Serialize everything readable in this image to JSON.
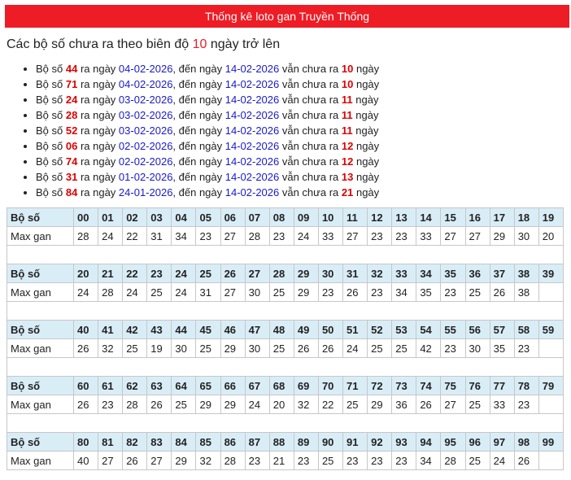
{
  "header": {
    "title": "Thống kê loto gan Truyền Thống"
  },
  "subtitle": {
    "prefix": "Các bộ số chưa ra theo biên độ ",
    "amplitude": "10",
    "suffix": " ngày trở lên"
  },
  "gan_list": {
    "label_prefix": "Bộ số ",
    "label_ra_ngay": " ra ngày ",
    "label_den_ngay": ", đến ngày ",
    "label_van_chua_ra": " vẫn chưa ra ",
    "label_ngay": " ngày",
    "items": [
      {
        "number": "44",
        "last_date": "04-02-2026",
        "until_date": "14-02-2026",
        "days": "10"
      },
      {
        "number": "71",
        "last_date": "04-02-2026",
        "until_date": "14-02-2026",
        "days": "10"
      },
      {
        "number": "24",
        "last_date": "03-02-2026",
        "until_date": "14-02-2026",
        "days": "11"
      },
      {
        "number": "28",
        "last_date": "03-02-2026",
        "until_date": "14-02-2026",
        "days": "11"
      },
      {
        "number": "52",
        "last_date": "03-02-2026",
        "until_date": "14-02-2026",
        "days": "11"
      },
      {
        "number": "06",
        "last_date": "02-02-2026",
        "until_date": "14-02-2026",
        "days": "12"
      },
      {
        "number": "74",
        "last_date": "02-02-2026",
        "until_date": "14-02-2026",
        "days": "12"
      },
      {
        "number": "31",
        "last_date": "01-02-2026",
        "until_date": "14-02-2026",
        "days": "13"
      },
      {
        "number": "84",
        "last_date": "24-01-2026",
        "until_date": "14-02-2026",
        "days": "21"
      }
    ]
  },
  "table": {
    "row_label_numbers": "Bộ số",
    "row_label_max": "Max gan",
    "blocks": [
      {
        "numbers": [
          "00",
          "01",
          "02",
          "03",
          "04",
          "05",
          "06",
          "07",
          "08",
          "09",
          "10",
          "11",
          "12",
          "13",
          "14",
          "15",
          "16",
          "17",
          "18",
          "19"
        ],
        "max": [
          "28",
          "24",
          "22",
          "31",
          "34",
          "23",
          "27",
          "28",
          "23",
          "24",
          "33",
          "27",
          "23",
          "23",
          "33",
          "27",
          "27",
          "29",
          "30",
          "20"
        ]
      },
      {
        "numbers": [
          "20",
          "21",
          "22",
          "23",
          "24",
          "25",
          "26",
          "27",
          "28",
          "29",
          "30",
          "31",
          "32",
          "33",
          "34",
          "35",
          "36",
          "37",
          "38",
          "39"
        ],
        "max": [
          "24",
          "28",
          "24",
          "25",
          "24",
          "31",
          "27",
          "30",
          "25",
          "29",
          "23",
          "26",
          "23",
          "34",
          "35",
          "23",
          "25",
          "26",
          "38"
        ]
      },
      {
        "numbers": [
          "40",
          "41",
          "42",
          "43",
          "44",
          "45",
          "46",
          "47",
          "48",
          "49",
          "50",
          "51",
          "52",
          "53",
          "54",
          "55",
          "56",
          "57",
          "58",
          "59"
        ],
        "max": [
          "26",
          "32",
          "25",
          "19",
          "30",
          "25",
          "29",
          "30",
          "25",
          "26",
          "26",
          "24",
          "25",
          "25",
          "42",
          "23",
          "30",
          "35",
          "23"
        ]
      },
      {
        "numbers": [
          "60",
          "61",
          "62",
          "63",
          "64",
          "65",
          "66",
          "67",
          "68",
          "69",
          "70",
          "71",
          "72",
          "73",
          "74",
          "75",
          "76",
          "77",
          "78",
          "79"
        ],
        "max": [
          "26",
          "23",
          "28",
          "26",
          "25",
          "29",
          "29",
          "24",
          "20",
          "32",
          "22",
          "25",
          "29",
          "36",
          "26",
          "27",
          "25",
          "33",
          "23"
        ]
      },
      {
        "numbers": [
          "80",
          "81",
          "82",
          "83",
          "84",
          "85",
          "86",
          "87",
          "88",
          "89",
          "90",
          "91",
          "92",
          "93",
          "94",
          "95",
          "96",
          "97",
          "98",
          "99"
        ],
        "max": [
          "40",
          "27",
          "26",
          "27",
          "29",
          "32",
          "28",
          "23",
          "21",
          "23",
          "25",
          "23",
          "23",
          "23",
          "34",
          "28",
          "25",
          "24",
          "26"
        ]
      }
    ]
  }
}
